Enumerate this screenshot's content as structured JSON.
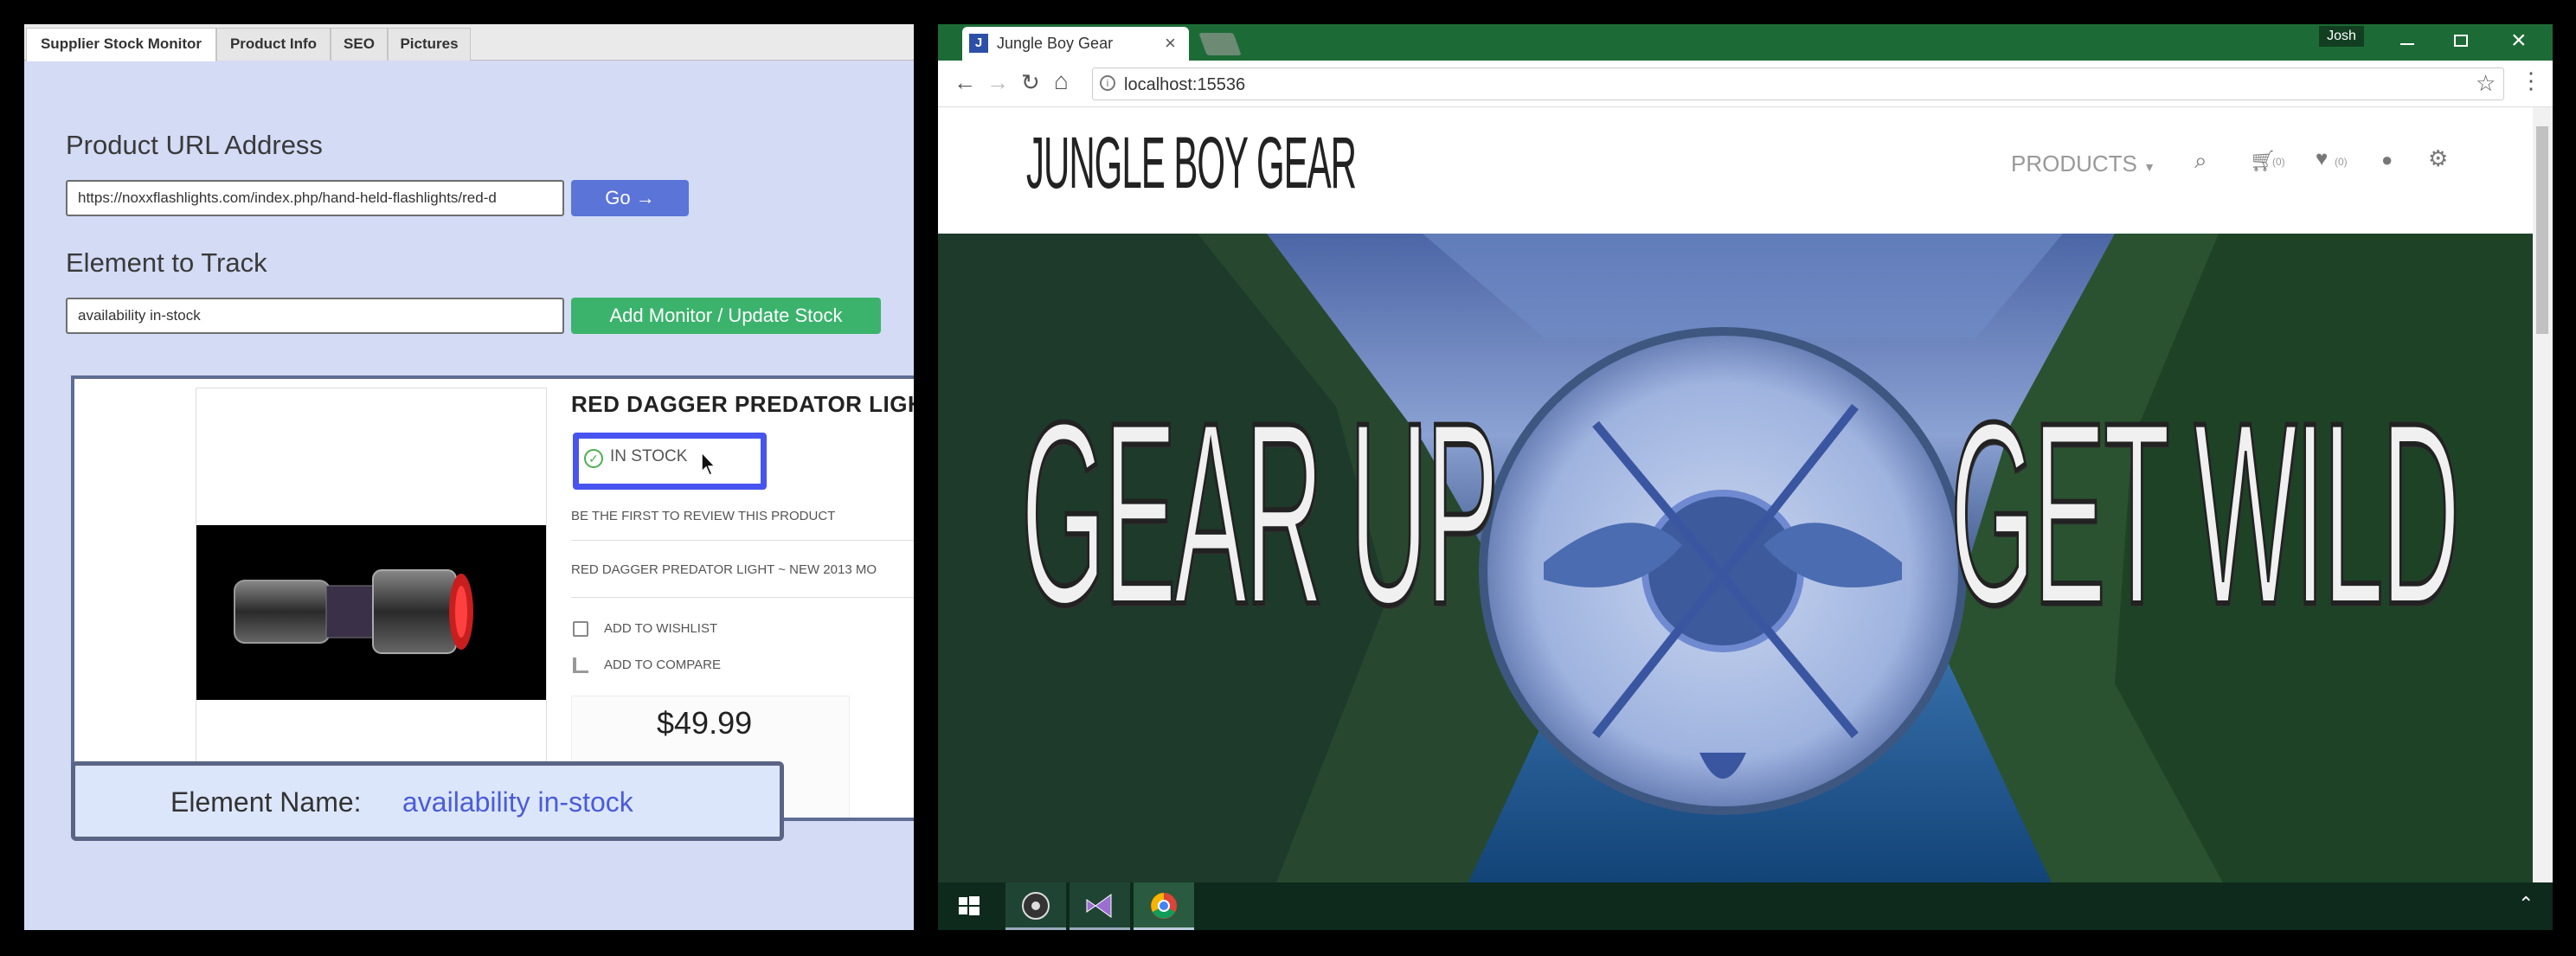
{
  "left_panel": {
    "tabs": [
      "Supplier Stock Monitor",
      "Product Info",
      "SEO",
      "Pictures"
    ],
    "url_section": {
      "title": "Product URL Address",
      "value": "https://noxxflashlights.com/index.php/hand-held-flashlights/red-d",
      "go_label": "Go →"
    },
    "element_section": {
      "title": "Element to Track",
      "value": "availability in-stock",
      "add_label": "Add Monitor / Update Stock"
    },
    "product_preview": {
      "title": "RED DAGGER PREDATOR LIGHT",
      "stock_text": "IN STOCK",
      "review_text": "BE THE FIRST TO REVIEW THIS PRODUCT",
      "desc_text": "RED DAGGER PREDATOR LIGHT ~ NEW 2013 MO",
      "wishlist_label": "ADD TO WISHLIST",
      "compare_label": "ADD TO COMPARE",
      "price": "$49.99"
    },
    "element_name": {
      "label": "Element Name:",
      "value": "availability in-stock"
    },
    "colors": {
      "go_button": "#5b74d8",
      "add_button": "#3bb36c",
      "highlight_border": "#4754f0"
    }
  },
  "browser": {
    "tab_title": "Jungle Boy Gear",
    "user": "Josh",
    "address": "localhost:15536",
    "site": {
      "logo_text": "JUNGLE BOY GEAR",
      "nav_products": "PRODUCTS",
      "cart_count": "(0)",
      "wishlist_count": "(0)",
      "hero_left": "GEAR UP",
      "hero_right": "GET WILD"
    },
    "colors": {
      "titlebar": "#1c6b36"
    }
  },
  "taskbar": {
    "icons": [
      "windows-start-icon",
      "obs-icon",
      "visual-studio-icon",
      "chrome-icon"
    ]
  }
}
